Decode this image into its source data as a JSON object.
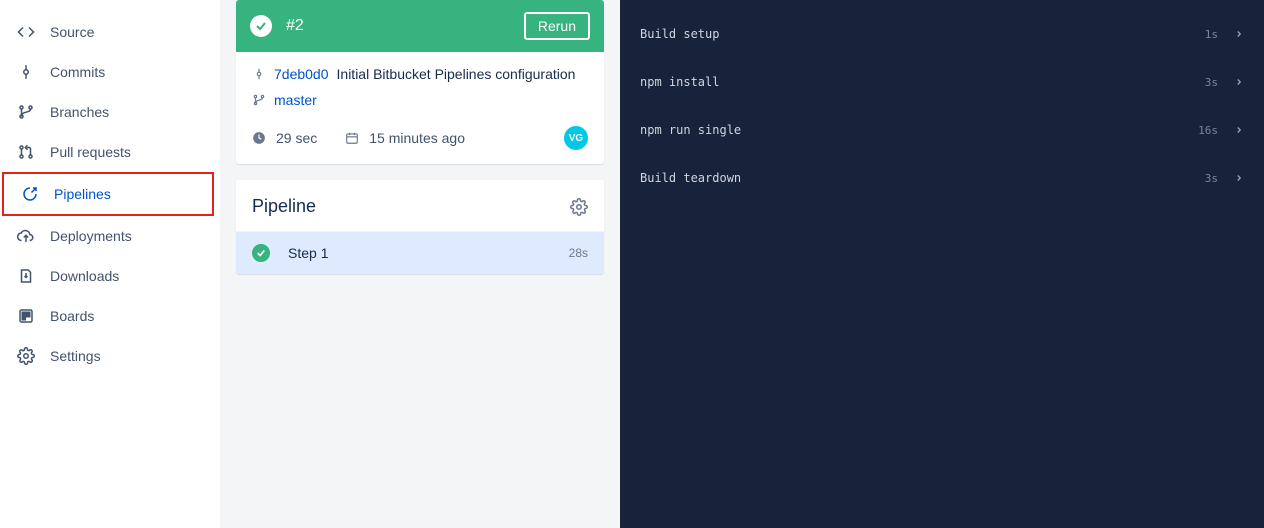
{
  "sidebar": {
    "items": [
      {
        "label": "Source"
      },
      {
        "label": "Commits"
      },
      {
        "label": "Branches"
      },
      {
        "label": "Pull requests"
      },
      {
        "label": "Pipelines"
      },
      {
        "label": "Deployments"
      },
      {
        "label": "Downloads"
      },
      {
        "label": "Boards"
      },
      {
        "label": "Settings"
      }
    ]
  },
  "run": {
    "number": "#2",
    "rerun_label": "Rerun",
    "commit_hash": "7deb0d0",
    "commit_message": "Initial Bitbucket Pipelines configuration",
    "branch": "master",
    "duration": "29 sec",
    "when": "15 minutes ago",
    "avatar_initials": "VG"
  },
  "pipeline": {
    "title": "Pipeline",
    "step_label": "Step 1",
    "step_time": "28s"
  },
  "logs": [
    {
      "label": "Build setup",
      "time": "1s"
    },
    {
      "label": "npm install",
      "time": "3s"
    },
    {
      "label": "npm run single",
      "time": "16s"
    },
    {
      "label": "Build teardown",
      "time": "3s"
    }
  ]
}
